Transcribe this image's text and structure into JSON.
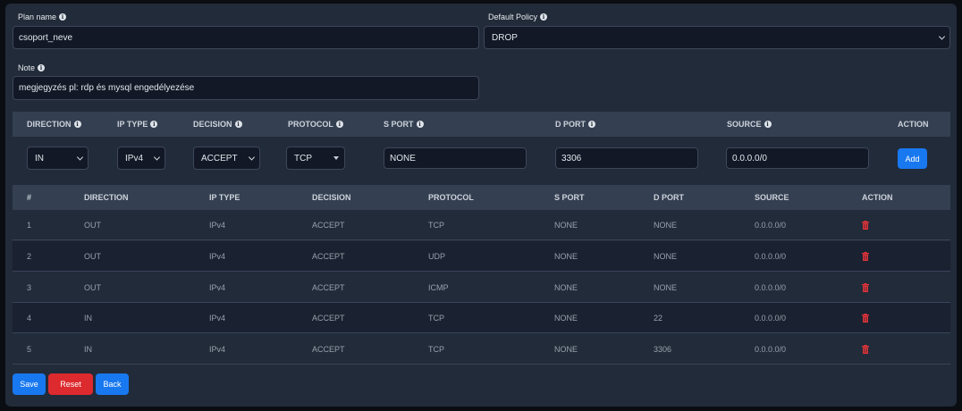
{
  "form": {
    "plan_name_label": "Plan name",
    "plan_name_value": "csoport_neve",
    "default_policy_label": "Default Policy",
    "default_policy_value": "DROP",
    "note_label": "Note",
    "note_value": "megjegyzés pl: rdp és mysql engedélyezése"
  },
  "rule_editor": {
    "headers": [
      "DIRECTION",
      "IP TYPE",
      "DECISION",
      "PROTOCOL",
      "S PORT",
      "D PORT",
      "SOURCE",
      "ACTION"
    ],
    "direction": "IN",
    "ip_type": "IPv4",
    "decision": "ACCEPT",
    "protocol": "TCP",
    "s_port": "NONE",
    "d_port": "3306",
    "source": "0.0.0.0/0",
    "add_label": "Add"
  },
  "rules_table": {
    "headers": [
      "#",
      "DIRECTION",
      "IP TYPE",
      "DECISION",
      "PROTOCOL",
      "S PORT",
      "D PORT",
      "SOURCE",
      "ACTION"
    ],
    "rows": [
      [
        "1",
        "OUT",
        "IPv4",
        "ACCEPT",
        "TCP",
        "NONE",
        "NONE",
        "0.0.0.0/0"
      ],
      [
        "2",
        "OUT",
        "IPv4",
        "ACCEPT",
        "UDP",
        "NONE",
        "NONE",
        "0.0.0.0/0"
      ],
      [
        "3",
        "OUT",
        "IPv4",
        "ACCEPT",
        "ICMP",
        "NONE",
        "NONE",
        "0.0.0.0/0"
      ],
      [
        "4",
        "IN",
        "IPv4",
        "ACCEPT",
        "TCP",
        "NONE",
        "22",
        "0.0.0.0/0"
      ],
      [
        "5",
        "IN",
        "IPv4",
        "ACCEPT",
        "TCP",
        "NONE",
        "3306",
        "0.0.0.0/0"
      ]
    ]
  },
  "footer": {
    "save_label": "Save",
    "reset_label": "Reset",
    "back_label": "Back"
  },
  "colors": {
    "primary": "#1878f0",
    "danger": "#dd2a2e",
    "panel": "#222b39",
    "header": "#343f51"
  },
  "icons": {
    "info": "info-circle-icon",
    "delete": "trash-icon"
  }
}
